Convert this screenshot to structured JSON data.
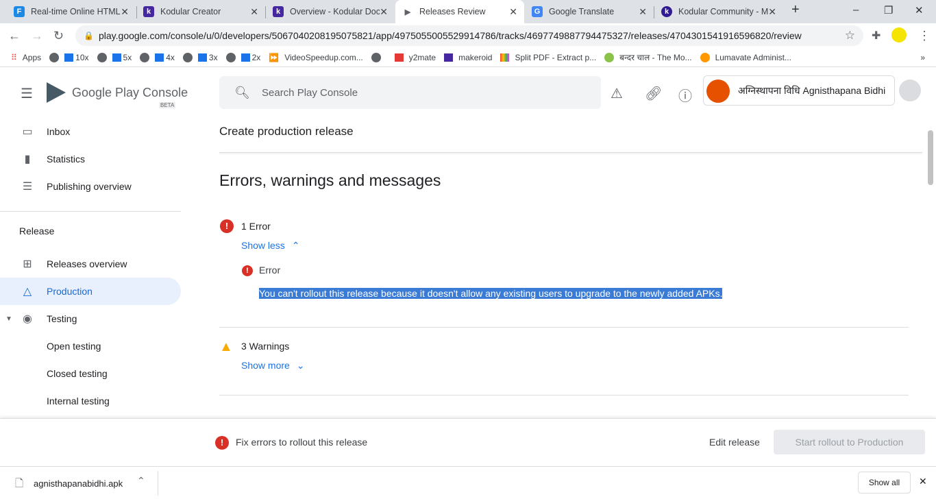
{
  "browser": {
    "tabs": [
      {
        "title": "Real-time Online HTML",
        "icon": "F",
        "color": "#1e88e5"
      },
      {
        "title": "Kodular Creator",
        "icon": "k",
        "color": "#4527a0"
      },
      {
        "title": "Overview - Kodular Doc",
        "icon": "k",
        "color": "#4527a0"
      },
      {
        "title": "Releases Review",
        "icon": "▶",
        "color": "#5f6368"
      },
      {
        "title": "Google Translate",
        "icon": "G",
        "color": "#4285f4"
      },
      {
        "title": "Kodular Community - M",
        "icon": "k",
        "color": "#311b92"
      }
    ],
    "url": "play.google.com/console/u/0/developers/5067040208195075821/app/4975055005529914786/tracks/4697749887794475327/releases/4704301541916596820/review",
    "bookmarks": [
      "Apps",
      "10x",
      "5x",
      "4x",
      "3x",
      "2x",
      "VideoSpeedup.com...",
      "y2mate",
      "makeroid",
      "Split PDF - Extract p...",
      "बन्दर चाल - The Mo...",
      "Lumavate Administ..."
    ]
  },
  "header": {
    "logo": "Google Play Console",
    "beta": "BETA",
    "search_placeholder": "Search Play Console",
    "account": "अग्निस्थापना विधि Agnisthapana Bidhi"
  },
  "sidebar": {
    "items": [
      {
        "label": "Inbox",
        "icon": "▭"
      },
      {
        "label": "Statistics",
        "icon": "▮"
      },
      {
        "label": "Publishing overview",
        "icon": "☰"
      }
    ],
    "section": "Release",
    "release_items": [
      {
        "label": "Releases overview",
        "icon": "⊞"
      },
      {
        "label": "Production",
        "icon": "△"
      },
      {
        "label": "Testing",
        "icon": "◉"
      },
      {
        "label": "Open testing"
      },
      {
        "label": "Closed testing"
      },
      {
        "label": "Internal testing"
      }
    ]
  },
  "main": {
    "page_title": "Create production release",
    "section_title": "Errors, warnings and messages",
    "errors": {
      "label": "1 Error",
      "toggle": "Show less",
      "item_title": "Error",
      "item_text": "You can't rollout this release because it doesn't allow any existing users to upgrade to the newly added APKs."
    },
    "warnings": {
      "label": "3 Warnings",
      "toggle": "Show more"
    }
  },
  "footer": {
    "message": "Fix errors to rollout this release",
    "edit": "Edit release",
    "rollout": "Start rollout to Production"
  },
  "download": {
    "file": "agnisthapanabidhi.apk",
    "show_all": "Show all"
  }
}
